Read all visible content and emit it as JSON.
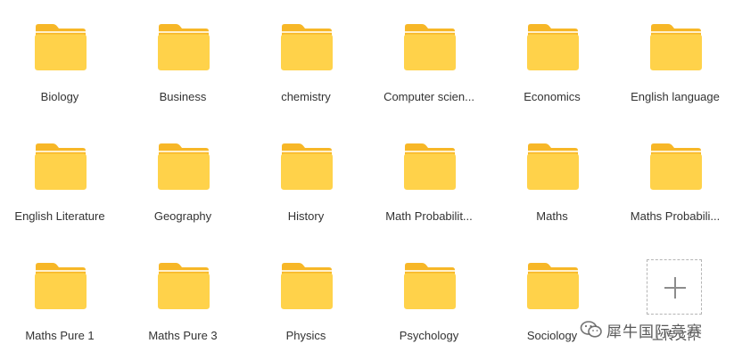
{
  "folders": [
    {
      "label": "Biology"
    },
    {
      "label": "Business"
    },
    {
      "label": "chemistry"
    },
    {
      "label": "Computer scien..."
    },
    {
      "label": "Economics"
    },
    {
      "label": "English language"
    },
    {
      "label": "English Literature"
    },
    {
      "label": "Geography"
    },
    {
      "label": "History"
    },
    {
      "label": "Math Probabilit..."
    },
    {
      "label": "Maths"
    },
    {
      "label": "Maths Probabili..."
    },
    {
      "label": "Maths Pure 1"
    },
    {
      "label": "Maths Pure 3"
    },
    {
      "label": "Physics"
    },
    {
      "label": "Psychology"
    },
    {
      "label": "Sociology"
    }
  ],
  "upload": {
    "label": "上传文件",
    "icon": "plus-icon"
  },
  "watermark": {
    "text": "犀牛国际竞赛",
    "icon": "wechat-icon"
  },
  "colors": {
    "folder_back": "#F7B727",
    "folder_front": "#FFD24A",
    "label_text": "#333333"
  }
}
